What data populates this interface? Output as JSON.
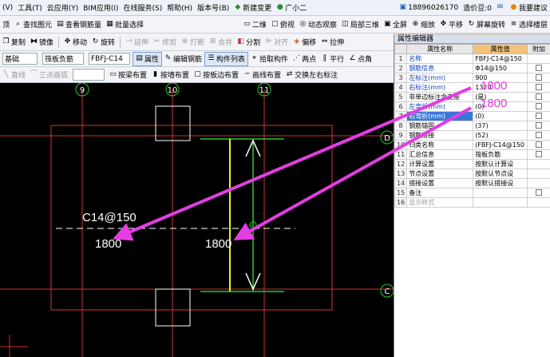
{
  "menubar": {
    "items": [
      "(V)",
      "工具(T)",
      "云应用(Y)",
      "BIM应用(I)",
      "在线服务(S)",
      "帮助(H)",
      "版本号(B)"
    ],
    "new_change": "新建变更",
    "guang": "广小二",
    "phone": "18896026170",
    "beans": "造价豆:0",
    "suggest": "我要建议"
  },
  "toolbar1": {
    "items": [
      "顶",
      "查找图元",
      "查看钢筋量",
      "批量选择"
    ],
    "right": [
      "二维",
      "俯视",
      "动态观察",
      "局部三维",
      "全屏",
      "缩放",
      "平移",
      "屏幕旋转",
      "选择楼层"
    ]
  },
  "toolbar2": {
    "items": [
      "复制",
      "镜像",
      "移动",
      "旋转",
      "延伸",
      "修剪",
      "打断",
      "合并",
      "分割",
      "对齐",
      "偏移",
      "拉伸"
    ]
  },
  "toolbar3": {
    "layer": "基础",
    "type": "筏板负筋",
    "name": "FBFJ-C14",
    "items": [
      "属性",
      "编辑钢筋",
      "构件列表",
      "拾取构件",
      "两点",
      "平行",
      "点角"
    ]
  },
  "toolbar4": {
    "items": [
      "直线",
      "三点画弧",
      "按梁布置",
      "按墙布置",
      "按板边布置",
      "画线布置",
      "交换左右标注"
    ]
  },
  "canvas": {
    "axis": [
      "9",
      "10",
      "11"
    ],
    "side_axis": [
      "D",
      "C"
    ],
    "label": "C14@150",
    "dim_left": "1800",
    "dim_right": "1800",
    "ann1": "1800",
    "ann2": "1800"
  },
  "panel": {
    "title": "属性编辑器",
    "headers": [
      "属性名称",
      "属性值",
      "附加"
    ],
    "rows": [
      {
        "no": "1",
        "name": "名称",
        "value": "FBFJ-C14@150",
        "check": false
      },
      {
        "no": "2",
        "name": "钢筋信息",
        "value": "Φ14@150",
        "check": true
      },
      {
        "no": "3",
        "name": "左标注(mm)",
        "value": "900",
        "check": true
      },
      {
        "no": "4",
        "name": "右标注(mm)",
        "value": "1320",
        "check": true
      },
      {
        "no": "5",
        "name": "非单边标注含支座",
        "value": "(是)",
        "check": true
      },
      {
        "no": "6",
        "name": "左弯折(mm)",
        "value": "(0)",
        "check": true
      },
      {
        "no": "7",
        "name": "右弯折(mm)",
        "value": "(0)",
        "check": true
      },
      {
        "no": "8",
        "name": "钢筋锚固",
        "value": "(37)",
        "check": true
      },
      {
        "no": "9",
        "name": "钢筋搭接",
        "value": "(52)",
        "check": true
      },
      {
        "no": "10",
        "name": "归类名称",
        "value": "(FBFJ-C14@150",
        "check": true
      },
      {
        "no": "11",
        "name": "汇总信息",
        "value": "筏板负筋",
        "check": true
      },
      {
        "no": "12",
        "name": "计算设置",
        "value": "按默认计算设",
        "check": false
      },
      {
        "no": "13",
        "name": "节点设置",
        "value": "按默认节点设",
        "check": false
      },
      {
        "no": "14",
        "name": "搭接设置",
        "value": "按默认搭接设",
        "check": false
      },
      {
        "no": "15",
        "name": "备注",
        "value": "",
        "check": true
      },
      {
        "no": "16",
        "name": "显示样式",
        "value": "",
        "check": false
      }
    ]
  }
}
